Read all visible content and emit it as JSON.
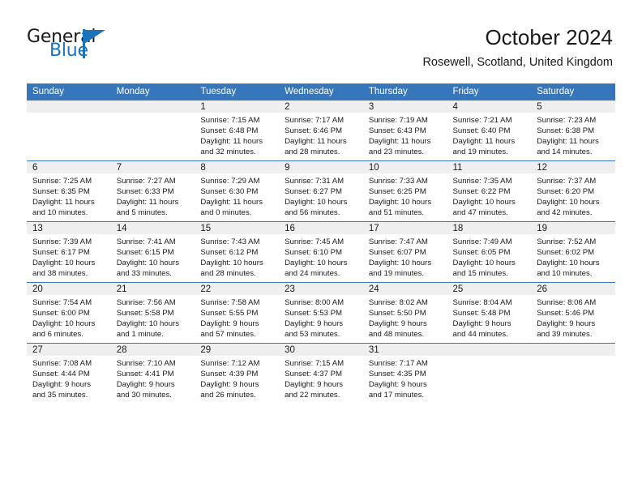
{
  "brand": {
    "name_line1": "General",
    "name_line2": "Blue",
    "flag_icon": "triangle-flag-icon",
    "accent_color": "#1b73ba"
  },
  "header": {
    "title": "October 2024",
    "subtitle": "Rosewell, Scotland, United Kingdom",
    "header_bg_color": "#3876bc",
    "daynum_bg_color": "#efefef"
  },
  "weekdays": [
    "Sunday",
    "Monday",
    "Tuesday",
    "Wednesday",
    "Thursday",
    "Friday",
    "Saturday"
  ],
  "labels": {
    "sunrise": "Sunrise:",
    "sunset": "Sunset:",
    "daylight": "Daylight:"
  },
  "weeks": [
    [
      {
        "empty": true
      },
      {
        "empty": true
      },
      {
        "day": "1",
        "sunrise": "Sunrise: 7:15 AM",
        "sunset": "Sunset: 6:48 PM",
        "daylight_l1": "Daylight: 11 hours",
        "daylight_l2": "and 32 minutes."
      },
      {
        "day": "2",
        "sunrise": "Sunrise: 7:17 AM",
        "sunset": "Sunset: 6:46 PM",
        "daylight_l1": "Daylight: 11 hours",
        "daylight_l2": "and 28 minutes."
      },
      {
        "day": "3",
        "sunrise": "Sunrise: 7:19 AM",
        "sunset": "Sunset: 6:43 PM",
        "daylight_l1": "Daylight: 11 hours",
        "daylight_l2": "and 23 minutes."
      },
      {
        "day": "4",
        "sunrise": "Sunrise: 7:21 AM",
        "sunset": "Sunset: 6:40 PM",
        "daylight_l1": "Daylight: 11 hours",
        "daylight_l2": "and 19 minutes."
      },
      {
        "day": "5",
        "sunrise": "Sunrise: 7:23 AM",
        "sunset": "Sunset: 6:38 PM",
        "daylight_l1": "Daylight: 11 hours",
        "daylight_l2": "and 14 minutes."
      }
    ],
    [
      {
        "day": "6",
        "sunrise": "Sunrise: 7:25 AM",
        "sunset": "Sunset: 6:35 PM",
        "daylight_l1": "Daylight: 11 hours",
        "daylight_l2": "and 10 minutes."
      },
      {
        "day": "7",
        "sunrise": "Sunrise: 7:27 AM",
        "sunset": "Sunset: 6:33 PM",
        "daylight_l1": "Daylight: 11 hours",
        "daylight_l2": "and 5 minutes."
      },
      {
        "day": "8",
        "sunrise": "Sunrise: 7:29 AM",
        "sunset": "Sunset: 6:30 PM",
        "daylight_l1": "Daylight: 11 hours",
        "daylight_l2": "and 0 minutes."
      },
      {
        "day": "9",
        "sunrise": "Sunrise: 7:31 AM",
        "sunset": "Sunset: 6:27 PM",
        "daylight_l1": "Daylight: 10 hours",
        "daylight_l2": "and 56 minutes."
      },
      {
        "day": "10",
        "sunrise": "Sunrise: 7:33 AM",
        "sunset": "Sunset: 6:25 PM",
        "daylight_l1": "Daylight: 10 hours",
        "daylight_l2": "and 51 minutes."
      },
      {
        "day": "11",
        "sunrise": "Sunrise: 7:35 AM",
        "sunset": "Sunset: 6:22 PM",
        "daylight_l1": "Daylight: 10 hours",
        "daylight_l2": "and 47 minutes."
      },
      {
        "day": "12",
        "sunrise": "Sunrise: 7:37 AM",
        "sunset": "Sunset: 6:20 PM",
        "daylight_l1": "Daylight: 10 hours",
        "daylight_l2": "and 42 minutes."
      }
    ],
    [
      {
        "day": "13",
        "sunrise": "Sunrise: 7:39 AM",
        "sunset": "Sunset: 6:17 PM",
        "daylight_l1": "Daylight: 10 hours",
        "daylight_l2": "and 38 minutes."
      },
      {
        "day": "14",
        "sunrise": "Sunrise: 7:41 AM",
        "sunset": "Sunset: 6:15 PM",
        "daylight_l1": "Daylight: 10 hours",
        "daylight_l2": "and 33 minutes."
      },
      {
        "day": "15",
        "sunrise": "Sunrise: 7:43 AM",
        "sunset": "Sunset: 6:12 PM",
        "daylight_l1": "Daylight: 10 hours",
        "daylight_l2": "and 28 minutes."
      },
      {
        "day": "16",
        "sunrise": "Sunrise: 7:45 AM",
        "sunset": "Sunset: 6:10 PM",
        "daylight_l1": "Daylight: 10 hours",
        "daylight_l2": "and 24 minutes."
      },
      {
        "day": "17",
        "sunrise": "Sunrise: 7:47 AM",
        "sunset": "Sunset: 6:07 PM",
        "daylight_l1": "Daylight: 10 hours",
        "daylight_l2": "and 19 minutes."
      },
      {
        "day": "18",
        "sunrise": "Sunrise: 7:49 AM",
        "sunset": "Sunset: 6:05 PM",
        "daylight_l1": "Daylight: 10 hours",
        "daylight_l2": "and 15 minutes."
      },
      {
        "day": "19",
        "sunrise": "Sunrise: 7:52 AM",
        "sunset": "Sunset: 6:02 PM",
        "daylight_l1": "Daylight: 10 hours",
        "daylight_l2": "and 10 minutes."
      }
    ],
    [
      {
        "day": "20",
        "sunrise": "Sunrise: 7:54 AM",
        "sunset": "Sunset: 6:00 PM",
        "daylight_l1": "Daylight: 10 hours",
        "daylight_l2": "and 6 minutes."
      },
      {
        "day": "21",
        "sunrise": "Sunrise: 7:56 AM",
        "sunset": "Sunset: 5:58 PM",
        "daylight_l1": "Daylight: 10 hours",
        "daylight_l2": "and 1 minute."
      },
      {
        "day": "22",
        "sunrise": "Sunrise: 7:58 AM",
        "sunset": "Sunset: 5:55 PM",
        "daylight_l1": "Daylight: 9 hours",
        "daylight_l2": "and 57 minutes."
      },
      {
        "day": "23",
        "sunrise": "Sunrise: 8:00 AM",
        "sunset": "Sunset: 5:53 PM",
        "daylight_l1": "Daylight: 9 hours",
        "daylight_l2": "and 53 minutes."
      },
      {
        "day": "24",
        "sunrise": "Sunrise: 8:02 AM",
        "sunset": "Sunset: 5:50 PM",
        "daylight_l1": "Daylight: 9 hours",
        "daylight_l2": "and 48 minutes."
      },
      {
        "day": "25",
        "sunrise": "Sunrise: 8:04 AM",
        "sunset": "Sunset: 5:48 PM",
        "daylight_l1": "Daylight: 9 hours",
        "daylight_l2": "and 44 minutes."
      },
      {
        "day": "26",
        "sunrise": "Sunrise: 8:06 AM",
        "sunset": "Sunset: 5:46 PM",
        "daylight_l1": "Daylight: 9 hours",
        "daylight_l2": "and 39 minutes."
      }
    ],
    [
      {
        "day": "27",
        "sunrise": "Sunrise: 7:08 AM",
        "sunset": "Sunset: 4:44 PM",
        "daylight_l1": "Daylight: 9 hours",
        "daylight_l2": "and 35 minutes."
      },
      {
        "day": "28",
        "sunrise": "Sunrise: 7:10 AM",
        "sunset": "Sunset: 4:41 PM",
        "daylight_l1": "Daylight: 9 hours",
        "daylight_l2": "and 30 minutes."
      },
      {
        "day": "29",
        "sunrise": "Sunrise: 7:12 AM",
        "sunset": "Sunset: 4:39 PM",
        "daylight_l1": "Daylight: 9 hours",
        "daylight_l2": "and 26 minutes."
      },
      {
        "day": "30",
        "sunrise": "Sunrise: 7:15 AM",
        "sunset": "Sunset: 4:37 PM",
        "daylight_l1": "Daylight: 9 hours",
        "daylight_l2": "and 22 minutes."
      },
      {
        "day": "31",
        "sunrise": "Sunrise: 7:17 AM",
        "sunset": "Sunset: 4:35 PM",
        "daylight_l1": "Daylight: 9 hours",
        "daylight_l2": "and 17 minutes."
      },
      {
        "empty": true
      },
      {
        "empty": true
      }
    ]
  ]
}
